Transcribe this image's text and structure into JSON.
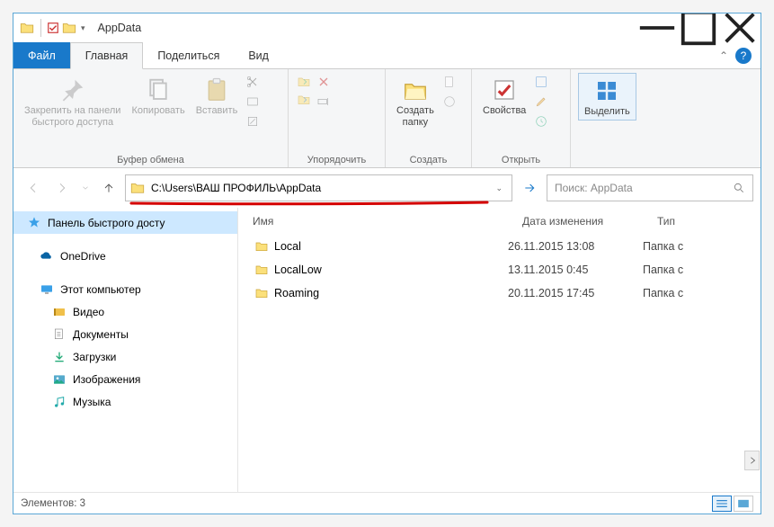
{
  "window": {
    "title": "AppData"
  },
  "tabs": {
    "file": "Файл",
    "home": "Главная",
    "share": "Поделиться",
    "view": "Вид"
  },
  "ribbon": {
    "pin": "Закрепить на панели\nбыстрого доступа",
    "copy": "Копировать",
    "paste": "Вставить",
    "clipboard_label": "Буфер обмена",
    "organize_label": "Упорядочить",
    "newfolder": "Создать\nпапку",
    "new_label": "Создать",
    "properties": "Свойства",
    "open_label": "Открыть",
    "select": "Выделить"
  },
  "address": {
    "path": "C:\\Users\\ВАШ ПРОФИЛЬ\\AppData"
  },
  "search": {
    "placeholder": "Поиск: AppData"
  },
  "nav": {
    "quick": "Панель быстрого досту",
    "onedrive": "OneDrive",
    "thispc": "Этот компьютер",
    "video": "Видео",
    "documents": "Документы",
    "downloads": "Загрузки",
    "pictures": "Изображения",
    "music": "Музыка"
  },
  "cols": {
    "name": "Имя",
    "date": "Дата изменения",
    "type": "Тип"
  },
  "files": [
    {
      "name": "Local",
      "date": "26.11.2015 13:08",
      "type": "Папка с"
    },
    {
      "name": "LocalLow",
      "date": "13.11.2015 0:45",
      "type": "Папка с"
    },
    {
      "name": "Roaming",
      "date": "20.11.2015 17:45",
      "type": "Папка с"
    }
  ],
  "status": {
    "count": "Элементов: 3"
  }
}
